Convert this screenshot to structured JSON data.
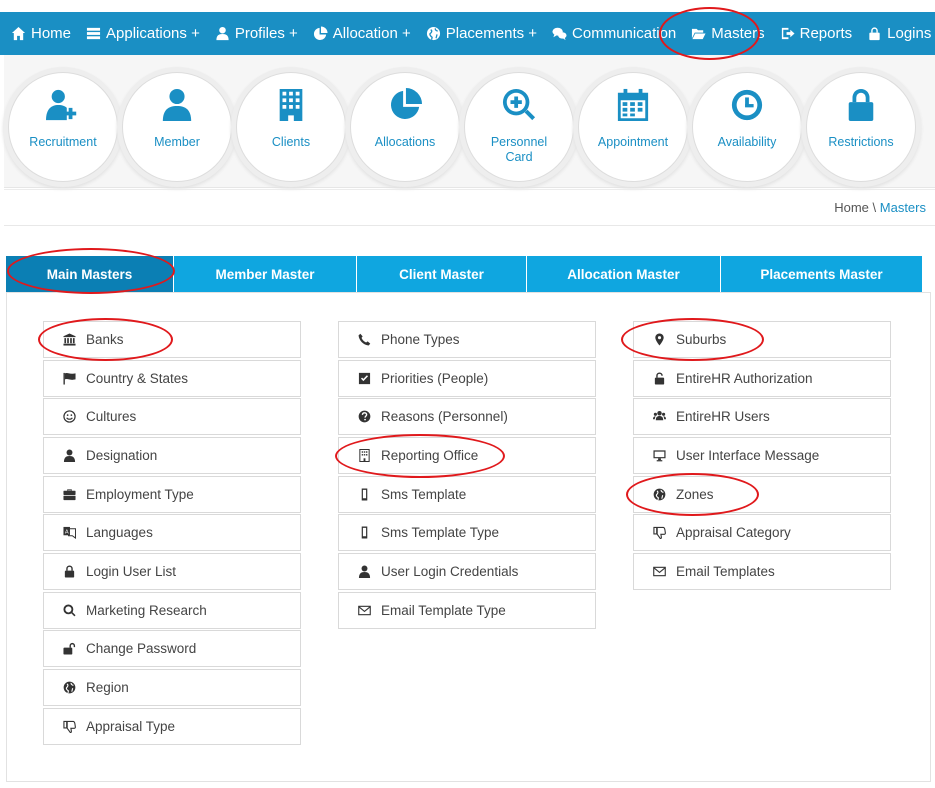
{
  "nav": {
    "items": [
      {
        "label": "Home",
        "icon": "home-icon"
      },
      {
        "label": "Applications +",
        "icon": "list-icon"
      },
      {
        "label": "Profiles +",
        "icon": "user-icon"
      },
      {
        "label": "Allocation +",
        "icon": "pie-icon"
      },
      {
        "label": "Placements +",
        "icon": "globe-icon"
      },
      {
        "label": "Communication",
        "icon": "chat-icon"
      },
      {
        "label": "Masters",
        "icon": "folder-open-icon"
      },
      {
        "label": "Reports",
        "icon": "share-icon"
      },
      {
        "label": "Logins +",
        "icon": "lock-icon"
      }
    ]
  },
  "quick": [
    {
      "label": "Recruitment",
      "icon": "user-plus-icon"
    },
    {
      "label": "Member",
      "icon": "user-icon"
    },
    {
      "label": "Clients",
      "icon": "building-icon"
    },
    {
      "label": "Allocations",
      "icon": "pie-icon"
    },
    {
      "label": "Personnel Card",
      "icon": "search-plus-icon"
    },
    {
      "label": "Appointment",
      "icon": "calendar-icon"
    },
    {
      "label": "Availability",
      "icon": "clock-icon"
    },
    {
      "label": "Restrictions",
      "icon": "lock-icon"
    }
  ],
  "breadcrumb": {
    "home": "Home",
    "sep": " \\ ",
    "current": "Masters"
  },
  "tabs": [
    {
      "label": "Main Masters",
      "active": true
    },
    {
      "label": "Member Master"
    },
    {
      "label": "Client Master"
    },
    {
      "label": "Allocation Master"
    },
    {
      "label": "Placements Master"
    }
  ],
  "columns": [
    [
      {
        "label": "Banks",
        "icon": "bank-icon"
      },
      {
        "label": "Country & States",
        "icon": "flag-icon"
      },
      {
        "label": "Cultures",
        "icon": "smile-icon"
      },
      {
        "label": "Designation",
        "icon": "user-icon"
      },
      {
        "label": "Employment Type",
        "icon": "briefcase-icon"
      },
      {
        "label": "Languages",
        "icon": "language-icon"
      },
      {
        "label": "Login User List",
        "icon": "lock-icon"
      },
      {
        "label": "Marketing Research",
        "icon": "search-icon"
      },
      {
        "label": "Change Password",
        "icon": "unlock-icon"
      },
      {
        "label": "Region",
        "icon": "globe-icon"
      },
      {
        "label": "Appraisal Type",
        "icon": "thumbs-down-icon"
      }
    ],
    [
      {
        "label": "Phone Types",
        "icon": "phone-icon"
      },
      {
        "label": "Priorities (People)",
        "icon": "check-square-icon"
      },
      {
        "label": "Reasons (Personnel)",
        "icon": "question-circle-icon"
      },
      {
        "label": "Reporting Office",
        "icon": "building-icon"
      },
      {
        "label": "Sms Template",
        "icon": "mobile-icon"
      },
      {
        "label": "Sms Template Type",
        "icon": "mobile-icon"
      },
      {
        "label": "User Login Credentials",
        "icon": "user-icon"
      },
      {
        "label": "Email Template Type",
        "icon": "envelope-icon"
      }
    ],
    [
      {
        "label": "Suburbs",
        "icon": "map-marker-icon"
      },
      {
        "label": "EntireHR Authorization",
        "icon": "unlock-icon"
      },
      {
        "label": "EntireHR Users",
        "icon": "users-icon"
      },
      {
        "label": "User Interface Message",
        "icon": "desktop-icon"
      },
      {
        "label": "Zones",
        "icon": "globe-icon"
      },
      {
        "label": "Appraisal Category",
        "icon": "thumbs-down-icon"
      },
      {
        "label": "Email Templates",
        "icon": "envelope-icon"
      }
    ]
  ],
  "colors": {
    "brand": "#1a8fc4",
    "tab": "#0fa6e0",
    "tab_active": "#0b7fb4",
    "annotation": "#e0191c"
  }
}
